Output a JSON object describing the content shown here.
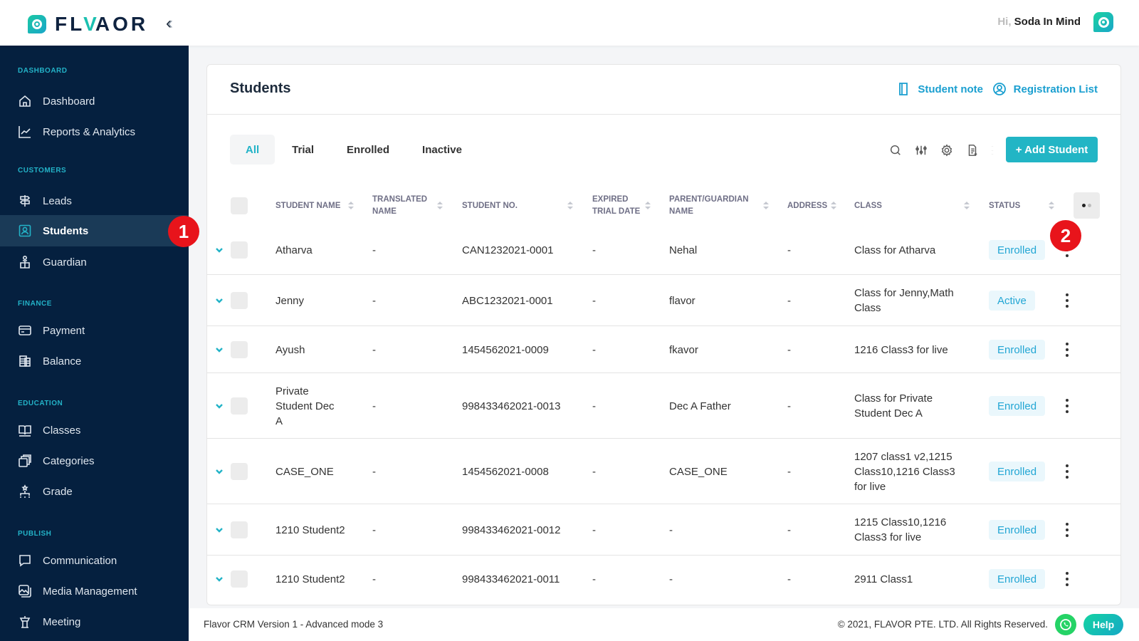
{
  "header": {
    "logo_text_prefix": "FL",
    "logo_text_v": "V",
    "logo_text_a": "A",
    "logo_text_suffix": "OR",
    "collapse_icon": "double-chevron-left",
    "greeting": "Hi,",
    "user_name": "Soda In Mind"
  },
  "sidebar": {
    "sections": [
      {
        "title": "DASHBOARD",
        "items": [
          {
            "label": "Dashboard",
            "icon": "home-icon"
          },
          {
            "label": "Reports & Analytics",
            "icon": "chart-line-icon"
          }
        ]
      },
      {
        "title": "CUSTOMERS",
        "items": [
          {
            "label": "Leads",
            "icon": "signpost-icon"
          },
          {
            "label": "Students",
            "icon": "student-icon",
            "active": true
          },
          {
            "label": "Guardian",
            "icon": "guardian-icon"
          }
        ]
      },
      {
        "title": "FINANCE",
        "items": [
          {
            "label": "Payment",
            "icon": "credit-card-icon"
          },
          {
            "label": "Balance",
            "icon": "balance-icon"
          }
        ]
      },
      {
        "title": "EDUCATION",
        "items": [
          {
            "label": "Classes",
            "icon": "book-icon"
          },
          {
            "label": "Categories",
            "icon": "categories-icon"
          },
          {
            "label": "Grade",
            "icon": "grade-icon"
          }
        ]
      },
      {
        "title": "PUBLISH",
        "items": [
          {
            "label": "Communication",
            "icon": "chat-icon"
          },
          {
            "label": "Media Management",
            "icon": "media-icon"
          },
          {
            "label": "Meeting",
            "icon": "podium-icon"
          }
        ]
      }
    ]
  },
  "annotations": [
    "1",
    "2"
  ],
  "page": {
    "title": "Students",
    "links": [
      {
        "label": "Student note",
        "icon": "notebook-icon"
      },
      {
        "label": "Registration List",
        "icon": "user-circle-icon"
      }
    ],
    "tabs": [
      {
        "label": "All",
        "active": true
      },
      {
        "label": "Trial"
      },
      {
        "label": "Enrolled"
      },
      {
        "label": "Inactive"
      }
    ],
    "tools": [
      "search-icon",
      "filter-sliders-icon",
      "gear-icon",
      "export-file-icon",
      "more-vertical-icon"
    ],
    "add_button": "+ Add Student"
  },
  "table": {
    "columns": [
      {
        "line1": "STUDENT NAME",
        "line2": ""
      },
      {
        "line1": "TRANSLATED",
        "line2": "NAME"
      },
      {
        "line1": "STUDENT NO.",
        "line2": ""
      },
      {
        "line1": "EXPIRED",
        "line2": "TRIAL DATE"
      },
      {
        "line1": "PARENT/GUARDIAN",
        "line2": "NAME"
      },
      {
        "line1": "ADDRESS",
        "line2": ""
      },
      {
        "line1": "CLASS",
        "line2": ""
      },
      {
        "line1": "STATUS",
        "line2": ""
      }
    ],
    "rows": [
      {
        "name": [
          "Atharva"
        ],
        "translated": "-",
        "student_no": "CAN1232021-0001",
        "expired": "-",
        "parent": "Nehal",
        "address": "-",
        "class": [
          "Class for Atharva"
        ],
        "status": "Enrolled"
      },
      {
        "name": [
          "Jenny"
        ],
        "translated": "-",
        "student_no": "ABC1232021-0001",
        "expired": "-",
        "parent": "flavor",
        "address": "-",
        "class": [
          "Class for Jenny,Math",
          "Class"
        ],
        "status": "Active"
      },
      {
        "name": [
          "Ayush"
        ],
        "translated": "-",
        "student_no": "1454562021-0009",
        "expired": "-",
        "parent": "fkavor",
        "address": "-",
        "class": [
          "1216 Class3 for live"
        ],
        "status": "Enrolled"
      },
      {
        "name": [
          "Private",
          "Student Dec",
          "A"
        ],
        "translated": "-",
        "student_no": "998433462021-0013",
        "expired": "-",
        "parent": "Dec A Father",
        "address": "-",
        "class": [
          "Class for Private",
          "Student Dec A"
        ],
        "status": "Enrolled"
      },
      {
        "name": [
          "CASE_ONE"
        ],
        "translated": "-",
        "student_no": "1454562021-0008",
        "expired": "-",
        "parent": "CASE_ONE",
        "address": "-",
        "class": [
          "1207 class1 v2,1215",
          "Class10,1216 Class3",
          "for live"
        ],
        "status": "Enrolled"
      },
      {
        "name": [
          "1210 Student2"
        ],
        "translated": "-",
        "student_no": "998433462021-0012",
        "expired": "-",
        "parent": "-",
        "address": "-",
        "class": [
          "1215 Class10,1216",
          "Class3 for live"
        ],
        "status": "Enrolled"
      },
      {
        "name": [
          "1210 Student2"
        ],
        "translated": "-",
        "student_no": "998433462021-0011",
        "expired": "-",
        "parent": "-",
        "address": "-",
        "class": [
          "2911 Class1"
        ],
        "status": "Enrolled"
      }
    ]
  },
  "footer": {
    "version": "Flavor CRM Version 1 - Advanced mode 3",
    "copyright": "© 2021, FLAVOR PTE. LTD. All Rights Reserved.",
    "help_label": "Help"
  },
  "colors": {
    "sidebar_bg": "#05203f",
    "accent": "#22b5c5",
    "link": "#1a9fd0",
    "badge_red": "#e8141b"
  }
}
